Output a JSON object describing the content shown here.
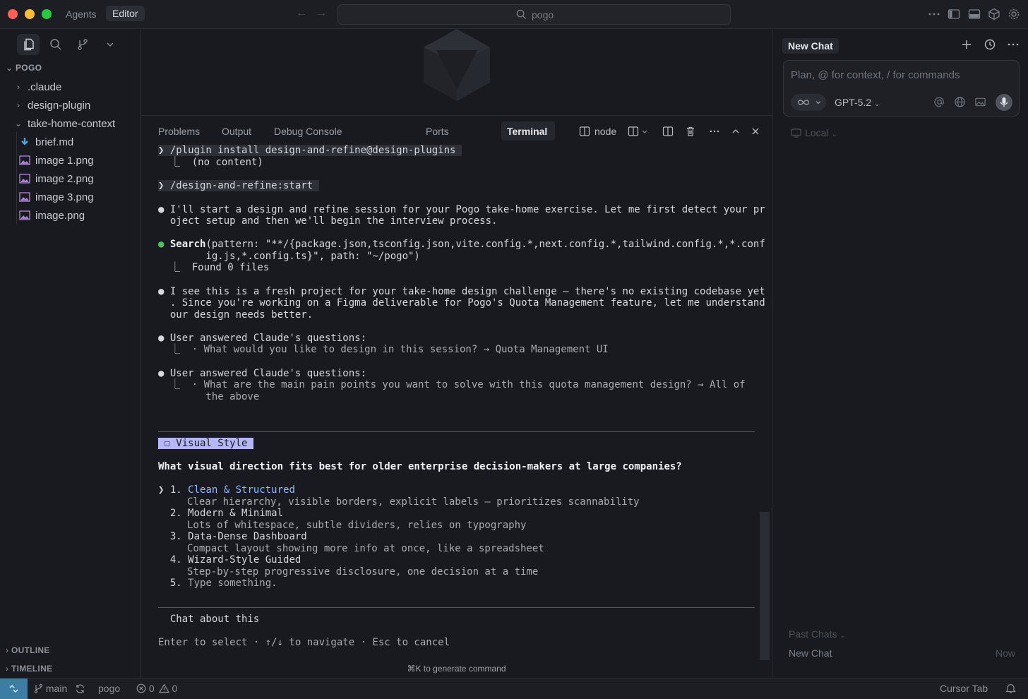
{
  "titlebar": {
    "agents_tab": "Agents",
    "editor_tab": "Editor",
    "search_text": "pogo"
  },
  "explorer": {
    "project": "POGO",
    "items": [
      {
        "label": ".claude",
        "kind": "folder",
        "expanded": false
      },
      {
        "label": "design-plugin",
        "kind": "folder",
        "expanded": false
      },
      {
        "label": "take-home-context",
        "kind": "folder",
        "expanded": true
      },
      {
        "label": "brief.md",
        "kind": "markdown"
      },
      {
        "label": "image 1.png",
        "kind": "image"
      },
      {
        "label": "image 2.png",
        "kind": "image"
      },
      {
        "label": "image 3.png",
        "kind": "image"
      },
      {
        "label": "image.png",
        "kind": "image"
      }
    ],
    "outline": "OUTLINE",
    "timeline": "TIMELINE"
  },
  "panel": {
    "tabs": [
      "Problems",
      "Output",
      "Debug Console",
      "Terminal",
      "Ports"
    ],
    "active_tab": "Terminal",
    "terminal_name": "node",
    "generate_hint": "⌘K to generate command"
  },
  "terminal": {
    "cmd1": "❯ /plugin install design-and-refine@design-plugins ",
    "cmd1_out": "  ⎿  (no content)",
    "cmd2": "❯ /design-and-refine:start ",
    "msg1_a": "● I'll start a design and refine session for your Pogo take-home exercise. Let me first detect your pr",
    "msg1_b": "  oject setup and then we'll begin the interview process.",
    "search_bullet": "●",
    "search_word": "Search",
    "search_a": "(pattern: \"**/{package.json,tsconfig.json,vite.config.*,next.config.*,tailwind.config.*,*.conf",
    "search_b": "        ig.js,*.config.ts}\", path: \"~/pogo\")",
    "search_out": "  ⎿  Found 0 files",
    "msg2_a": "● I see this is a fresh project for your take-home design challenge — there's no existing codebase yet",
    "msg2_b": "  . Since you're working on a Figma deliverable for Pogo's Quota Management feature, let me understand y",
    "msg2_c": "  our design needs better.",
    "q1_head": "● User answered Claude's questions:",
    "q1_ans": "  ⎿  · What would you like to design in this session? → Quota Management UI",
    "q2_head": "● User answered Claude's questions:",
    "q2_ans_a": "  ⎿  · What are the main pain points you want to solve with this quota management design? → All of",
    "q2_ans_b": "        the above",
    "section_badge": " ☐ Visual Style ",
    "question": "What visual direction fits best for older enterprise decision-makers at large companies?",
    "options": [
      {
        "prefix": "❯ 1. ",
        "title": "Clean & Structured",
        "desc": "Clear hierarchy, visible borders, explicit labels — prioritizes scannability",
        "selected": true
      },
      {
        "prefix": "  2. ",
        "title": "Modern & Minimal",
        "desc": "Lots of whitespace, subtle dividers, relies on typography",
        "selected": false
      },
      {
        "prefix": "  3. ",
        "title": "Data-Dense Dashboard",
        "desc": "Compact layout showing more info at once, like a spreadsheet",
        "selected": false
      },
      {
        "prefix": "  4. ",
        "title": "Wizard-Style Guided",
        "desc": "Step-by-step progressive disclosure, one decision at a time",
        "selected": false
      },
      {
        "prefix": "  5. ",
        "title": "Type something.",
        "desc": "",
        "selected": false
      }
    ],
    "chat_about": "  Chat about this",
    "footer_hint": "Enter to select · ↑/↓ to navigate · Esc to cancel"
  },
  "chat": {
    "title": "New Chat",
    "placeholder": "Plan, @ for context, / for commands",
    "model": "GPT-5.2",
    "local": "Local",
    "past_chats": "Past Chats",
    "past_item": "New Chat",
    "past_item_time": "Now"
  },
  "statusbar": {
    "branch": "main",
    "project": "pogo",
    "errors": "0",
    "warnings": "0",
    "cursor_tab": "Cursor Tab"
  },
  "colors": {
    "accent_blue": "#8fb8ff",
    "badge_lavender": "#b5b8f3",
    "success_green": "#4ec15a",
    "remote_blue": "#3c7ea3"
  }
}
